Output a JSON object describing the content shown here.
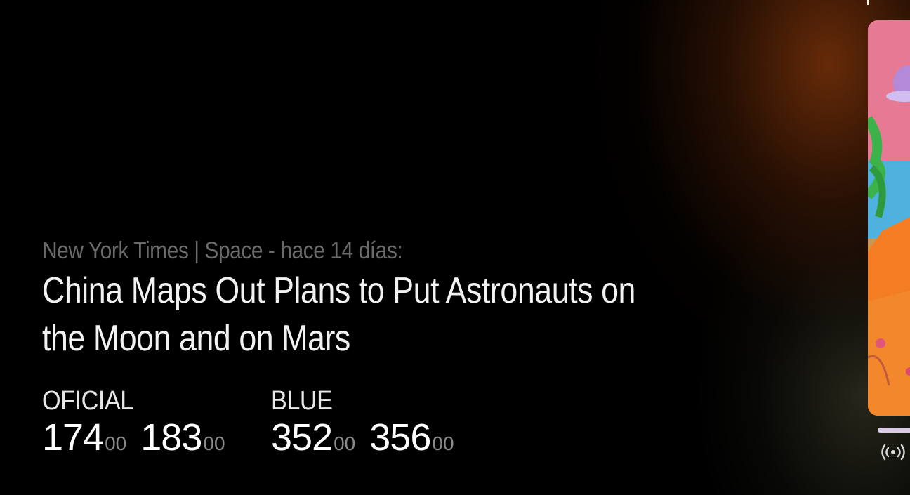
{
  "news": {
    "source_line": "New York Times | Space - hace 14 días:",
    "headline": "China Maps Out Plans to Put Astronauts on the Moon and on Mars"
  },
  "rates": [
    {
      "label": "OFICIAL",
      "values": [
        {
          "int": "174",
          "dec": "00"
        },
        {
          "int": "183",
          "dec": "00"
        }
      ]
    },
    {
      "label": "BLUE",
      "values": [
        {
          "int": "352",
          "dec": "00"
        },
        {
          "int": "356",
          "dec": "00"
        }
      ]
    }
  ],
  "icons": {
    "live": "broadcast-icon"
  },
  "colors": {
    "background": "#000000",
    "source_text": "#6a6a6a",
    "progress": "#d9cbe6"
  }
}
